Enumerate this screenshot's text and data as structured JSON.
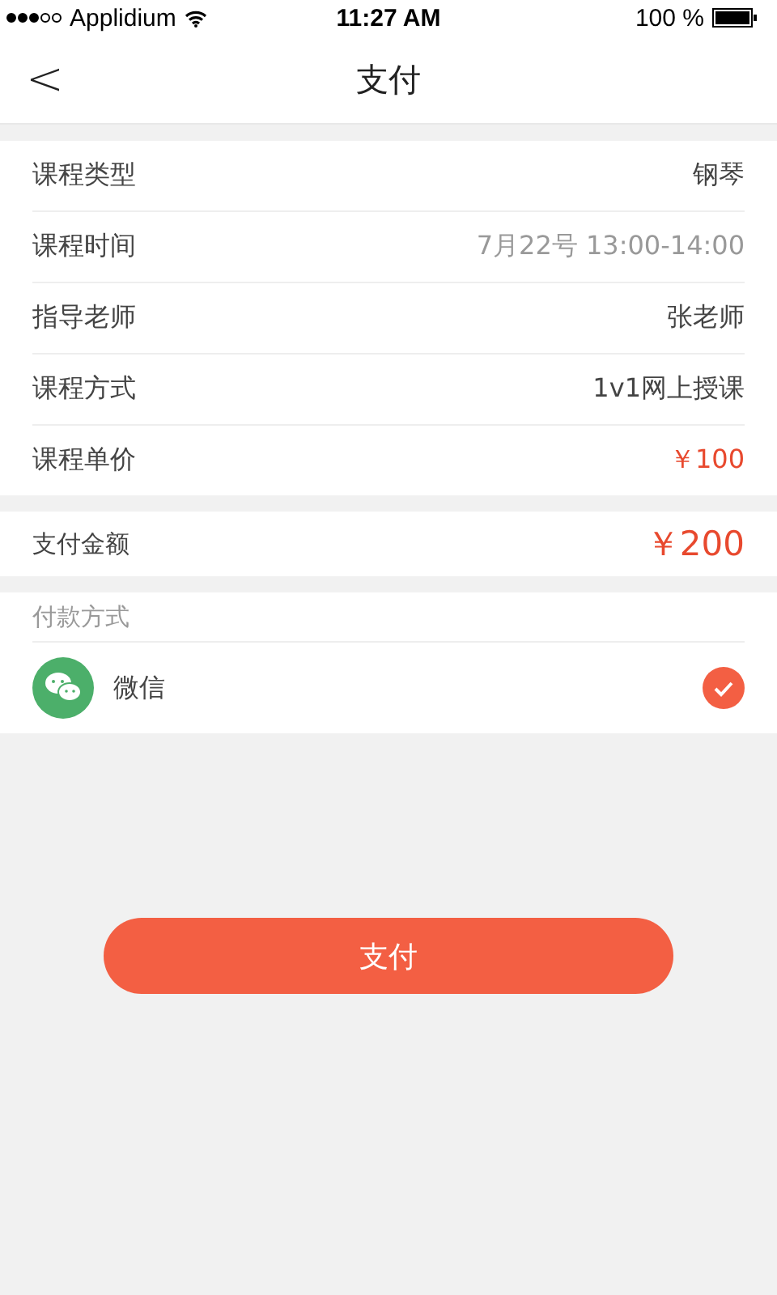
{
  "status_bar": {
    "carrier": "Applidium",
    "time": "11:27 AM",
    "battery": "100 %"
  },
  "nav": {
    "back": "<",
    "title": "支付"
  },
  "details": [
    {
      "label": "课程类型",
      "value": "钢琴",
      "kind": "text"
    },
    {
      "label": "课程时间",
      "value": "7月22号 13:00-14:00",
      "kind": "muted"
    },
    {
      "label": "指导老师",
      "value": "张老师",
      "kind": "text"
    },
    {
      "label": "课程方式",
      "value": "1v1网上授课",
      "kind": "text"
    },
    {
      "label": "课程单价",
      "value": "￥100",
      "kind": "price"
    }
  ],
  "amount": {
    "label": "支付金额",
    "value": "￥200"
  },
  "payment": {
    "heading": "付款方式",
    "methods": [
      {
        "name": "微信",
        "selected": true
      }
    ]
  },
  "pay_button": "支付"
}
